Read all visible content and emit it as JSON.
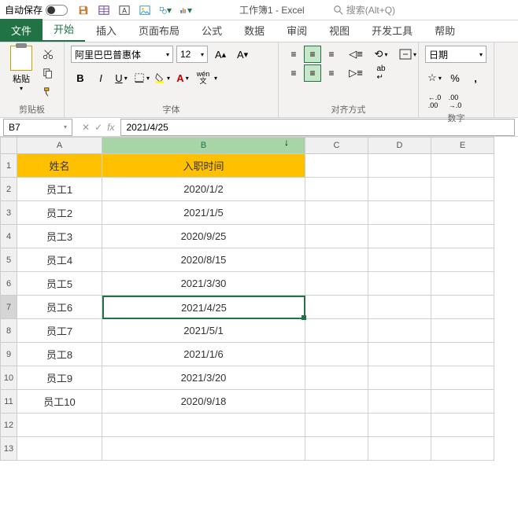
{
  "titlebar": {
    "autosave_label": "自动保存",
    "title": "工作簿1 - Excel",
    "search_placeholder": "搜索(Alt+Q)"
  },
  "tabs": {
    "file": "文件",
    "home": "开始",
    "insert": "插入",
    "pagelayout": "页面布局",
    "formulas": "公式",
    "data": "数据",
    "review": "审阅",
    "view": "视图",
    "developer": "开发工具",
    "help": "帮助"
  },
  "ribbon": {
    "clipboard_label": "剪贴板",
    "paste_label": "粘贴",
    "font_label": "字体",
    "font_name": "阿里巴巴普惠体",
    "font_size": "12",
    "align_label": "对齐方式",
    "number_label": "数字",
    "number_format": "日期",
    "wen_label": "wén 文"
  },
  "formula_bar": {
    "name_box": "B7",
    "fx": "fx",
    "value": "2021/4/25"
  },
  "columns": [
    "A",
    "B",
    "C",
    "D",
    "E"
  ],
  "headers": {
    "A": "姓名",
    "B": "入职时间"
  },
  "rows": [
    {
      "A": "员工1",
      "B": "2020/1/2"
    },
    {
      "A": "员工2",
      "B": "2021/1/5"
    },
    {
      "A": "员工3",
      "B": "2020/9/25"
    },
    {
      "A": "员工4",
      "B": "2020/8/15"
    },
    {
      "A": "员工5",
      "B": "2021/3/30"
    },
    {
      "A": "员工6",
      "B": "2021/4/25"
    },
    {
      "A": "员工7",
      "B": "2021/5/1"
    },
    {
      "A": "员工8",
      "B": "2021/1/6"
    },
    {
      "A": "员工9",
      "B": "2021/3/20"
    },
    {
      "A": "员工10",
      "B": "2020/9/18"
    }
  ],
  "selected_cell": "B7"
}
